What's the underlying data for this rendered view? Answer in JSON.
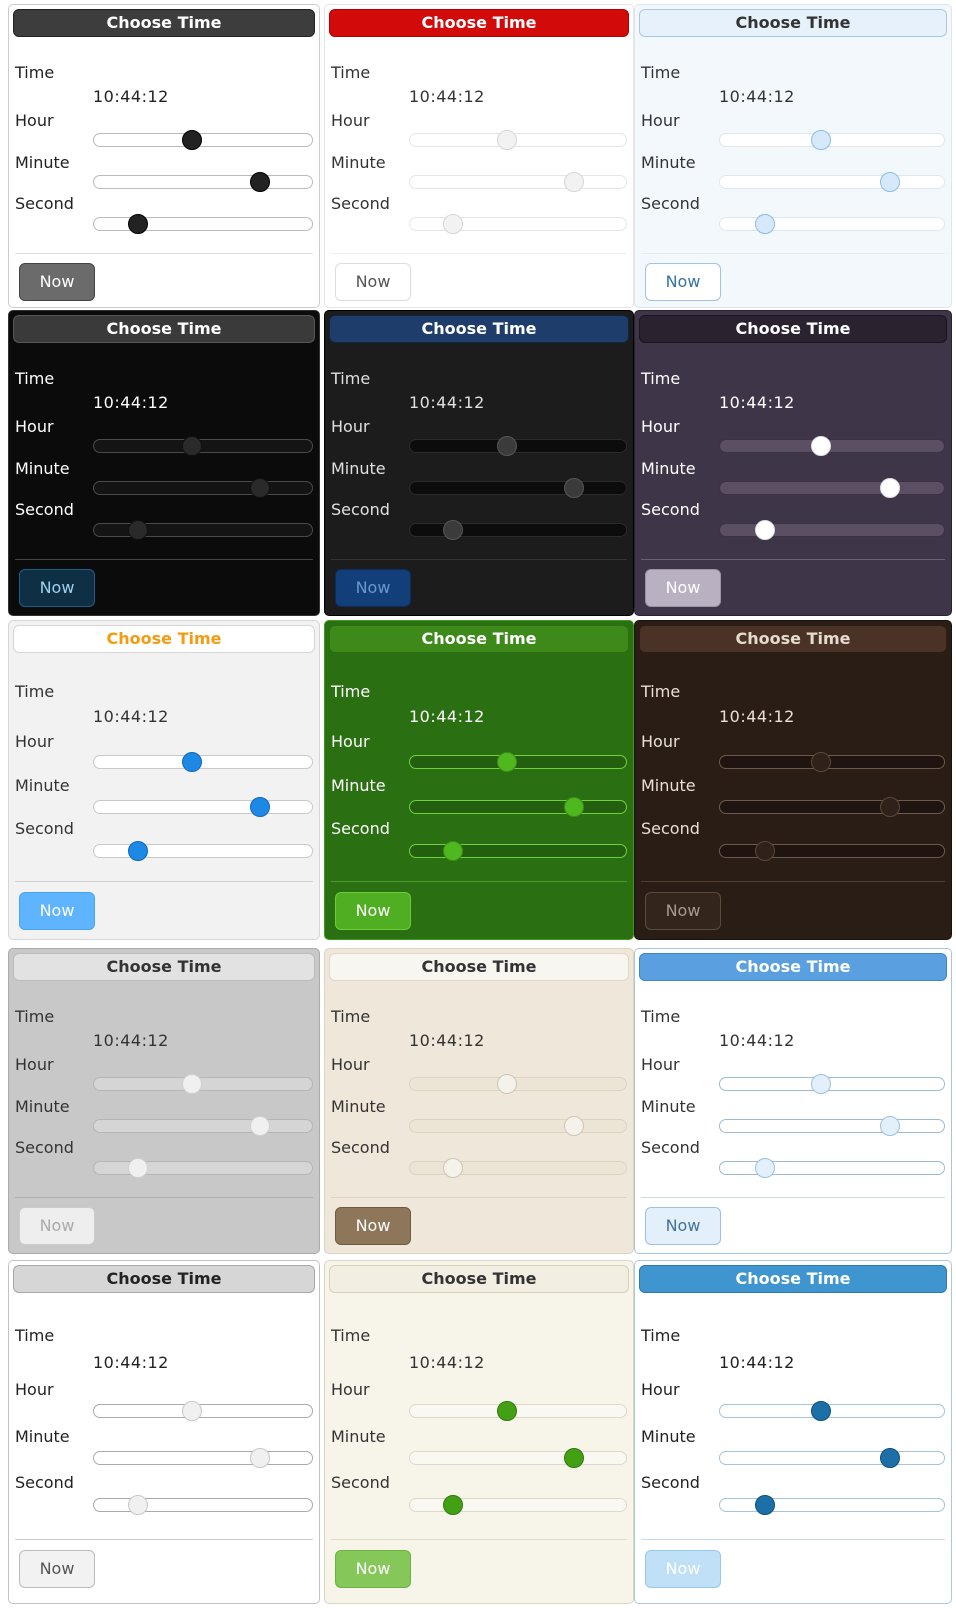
{
  "pickers": [
    {
      "header": "Choose Time",
      "labels": {
        "time": "Time",
        "hour": "Hour",
        "minute": "Minute",
        "second": "Second"
      },
      "time_value": "10:44:12",
      "hour_level": 0.45,
      "minute_level": 0.76,
      "second_level": 0.2,
      "now_label": "Now",
      "colors": {
        "bg": "#ffffff",
        "fg": "#222222",
        "border": "#cccccc",
        "header_bg": "#3d3d3d",
        "header_fg": "#ffffff",
        "header_border": "#222222",
        "track_bg": "#ffffff",
        "track_border": "#bbbbbb",
        "thumb": "#222222",
        "thumb_border": "#000000",
        "sep": "#dddddd",
        "btn_bg": "#6b6b6b",
        "btn_fg": "#ffffff",
        "btn_border": "#444444"
      }
    },
    {
      "header": "Choose Time",
      "labels": {
        "time": "Time",
        "hour": "Hour",
        "minute": "Minute",
        "second": "Second"
      },
      "time_value": "10:44:12",
      "hour_level": 0.45,
      "minute_level": 0.76,
      "second_level": 0.2,
      "now_label": "Now",
      "colors": {
        "bg": "#ffffff",
        "fg": "#333333",
        "border": "#e5e5e5",
        "header_bg": "#d20a0a",
        "header_fg": "#ffffff",
        "header_border": "#b00000",
        "track_bg": "#ffffff",
        "track_border": "#e6e6e6",
        "thumb": "#f2f2f2",
        "thumb_border": "#d6d6d6",
        "sep": "#eeeeee",
        "btn_bg": "#ffffff",
        "btn_fg": "#555555",
        "btn_border": "#dddddd"
      }
    },
    {
      "header": "Choose Time",
      "labels": {
        "time": "Time",
        "hour": "Hour",
        "minute": "Minute",
        "second": "Second"
      },
      "time_value": "10:44:12",
      "hour_level": 0.45,
      "minute_level": 0.76,
      "second_level": 0.2,
      "now_label": "Now",
      "colors": {
        "bg": "#f3f8fc",
        "fg": "#333333",
        "border": "#dde6ee",
        "header_bg": "#e6f1fb",
        "header_fg": "#333333",
        "header_border": "#a9c8e6",
        "track_bg": "#ffffff",
        "track_border": "#dfe6ee",
        "thumb": "#d5e9fb",
        "thumb_border": "#8bbbe8",
        "sep": "#e4ebf1",
        "btn_bg": "#ffffff",
        "btn_fg": "#3572a8",
        "btn_border": "#9ec3e6"
      }
    },
    {
      "header": "Choose Time",
      "labels": {
        "time": "Time",
        "hour": "Hour",
        "minute": "Minute",
        "second": "Second"
      },
      "time_value": "10:44:12",
      "hour_level": 0.45,
      "minute_level": 0.76,
      "second_level": 0.2,
      "now_label": "Now",
      "colors": {
        "bg": "#0b0b0b",
        "fg": "#ffffff",
        "border": "#333333",
        "header_bg": "#3a3a3a",
        "header_fg": "#ffffff",
        "header_border": "#555555",
        "track_bg": "#141414",
        "track_border": "#4a4a4a",
        "thumb": "#2a2a2a",
        "thumb_border": "#111111",
        "sep": "#444444",
        "btn_bg": "#0f2f45",
        "btn_fg": "#9fd0f0",
        "btn_border": "#1c5f8a"
      }
    },
    {
      "header": "Choose Time",
      "labels": {
        "time": "Time",
        "hour": "Hour",
        "minute": "Minute",
        "second": "Second"
      },
      "time_value": "10:44:12",
      "hour_level": 0.45,
      "minute_level": 0.76,
      "second_level": 0.2,
      "now_label": "Now",
      "colors": {
        "bg": "#1c1c1c",
        "fg": "#e0e0e0",
        "border": "#000000",
        "header_bg": "#1f3d6a",
        "header_fg": "#ffffff",
        "header_border": "#112440",
        "track_bg": "#0c0c0c",
        "track_border": "#2a2a2a",
        "thumb": "#3b3b3b",
        "thumb_border": "#555555",
        "sep": "#333333",
        "btn_bg": "#123f7a",
        "btn_fg": "#6c96cc",
        "btn_border": "#0c2c57"
      }
    },
    {
      "header": "Choose Time",
      "labels": {
        "time": "Time",
        "hour": "Hour",
        "minute": "Minute",
        "second": "Second"
      },
      "time_value": "10:44:12",
      "hour_level": 0.45,
      "minute_level": 0.76,
      "second_level": 0.2,
      "now_label": "Now",
      "colors": {
        "bg": "#3f3549",
        "fg": "#ffffff",
        "border": "#2a2230",
        "header_bg": "#2b2230",
        "header_fg": "#ffffff",
        "header_border": "#1b151f",
        "track_bg": "#5a4f63",
        "track_border": "#3b3342",
        "thumb": "#ffffff",
        "thumb_border": "#dddddd",
        "sep": "#6a5f73",
        "btn_bg": "#b9b0c1",
        "btn_fg": "#ffffff",
        "btn_border": "#9d93a6"
      }
    },
    {
      "header": "Choose Time",
      "labels": {
        "time": "Time",
        "hour": "Hour",
        "minute": "Minute",
        "second": "Second"
      },
      "time_value": "10:44:12",
      "hour_level": 0.45,
      "minute_level": 0.76,
      "second_level": 0.2,
      "now_label": "Now",
      "colors": {
        "bg": "#f2f2f2",
        "fg": "#333333",
        "border": "#d6d6d6",
        "header_bg": "#ffffff",
        "header_fg": "#f39c12",
        "header_border": "#d6d6d6",
        "track_bg": "#ffffff",
        "track_border": "#c9c9c9",
        "thumb": "#1e88e5",
        "thumb_border": "#1565c0",
        "sep": "#d0d0d0",
        "btn_bg": "#5eb4ff",
        "btn_fg": "#ffffff",
        "btn_border": "#4aa3f0"
      }
    },
    {
      "header": "Choose Time",
      "labels": {
        "time": "Time",
        "hour": "Hour",
        "minute": "Minute",
        "second": "Second"
      },
      "time_value": "10:44:12",
      "hour_level": 0.45,
      "minute_level": 0.76,
      "second_level": 0.2,
      "now_label": "Now",
      "colors": {
        "bg": "#2a6f12",
        "fg": "#ffffff",
        "border": "#3f9a1a",
        "header_bg": "#3d8a1a",
        "header_fg": "#ffffff",
        "header_border": "#2e6e12",
        "track_bg": "#245f10",
        "track_border": "#6ed23a",
        "thumb": "#4fb81f",
        "thumb_border": "#3a8f15",
        "sep": "#4a9a27",
        "btn_bg": "#4fae22",
        "btn_fg": "#ffffff",
        "btn_border": "#6ccc3a"
      }
    },
    {
      "header": "Choose Time",
      "labels": {
        "time": "Time",
        "hour": "Hour",
        "minute": "Minute",
        "second": "Second"
      },
      "time_value": "10:44:12",
      "hour_level": 0.45,
      "minute_level": 0.76,
      "second_level": 0.2,
      "now_label": "Now",
      "colors": {
        "bg": "#2a1d16",
        "fg": "#e8e0d8",
        "border": "#1c120d",
        "header_bg": "#4a3326",
        "header_fg": "#e5dccf",
        "header_border": "#2c1e16",
        "track_bg": "#1f140f",
        "track_border": "#6d5a4c",
        "thumb": "#2f221a",
        "thumb_border": "#5b4739",
        "sep": "#4e3d31",
        "btn_bg": "#33251c",
        "btn_fg": "#a59b8c",
        "btn_border": "#5b4b3e"
      }
    },
    {
      "header": "Choose Time",
      "labels": {
        "time": "Time",
        "hour": "Hour",
        "minute": "Minute",
        "second": "Second"
      },
      "time_value": "10:44:12",
      "hour_level": 0.45,
      "minute_level": 0.76,
      "second_level": 0.2,
      "now_label": "Now",
      "colors": {
        "bg": "#c8c8c8",
        "fg": "#333333",
        "border": "#aaaaaa",
        "header_bg": "#e2e2e2",
        "header_fg": "#333333",
        "header_border": "#bbbbbb",
        "track_bg": "#d5d5d5",
        "track_border": "#b5b5b5",
        "thumb": "#f0f0f0",
        "thumb_border": "#d0d0d0",
        "sep": "#b0b0b0",
        "btn_bg": "#eeeeee",
        "btn_fg": "#aaaaaa",
        "btn_border": "#cccccc"
      }
    },
    {
      "header": "Choose Time",
      "labels": {
        "time": "Time",
        "hour": "Hour",
        "minute": "Minute",
        "second": "Second"
      },
      "time_value": "10:44:12",
      "hour_level": 0.45,
      "minute_level": 0.76,
      "second_level": 0.2,
      "now_label": "Now",
      "colors": {
        "bg": "#efe8da",
        "fg": "#333333",
        "border": "#ddd3c2",
        "header_bg": "#f8f6f1",
        "header_fg": "#333333",
        "header_border": "#e2d8c8",
        "track_bg": "#ece5d6",
        "track_border": "#ddd3c2",
        "thumb": "#f5f2ec",
        "thumb_border": "#cfc4b3",
        "sep": "#ded4c4",
        "btn_bg": "#8d7659",
        "btn_fg": "#ffffff",
        "btn_border": "#6f5b43"
      }
    },
    {
      "header": "Choose Time",
      "labels": {
        "time": "Time",
        "hour": "Hour",
        "minute": "Minute",
        "second": "Second"
      },
      "time_value": "10:44:12",
      "hour_level": 0.45,
      "minute_level": 0.76,
      "second_level": 0.2,
      "now_label": "Now",
      "colors": {
        "bg": "#ffffff",
        "fg": "#333333",
        "border": "#a7c4e0",
        "header_bg": "#5aa0e0",
        "header_fg": "#ffffff",
        "header_border": "#3f86c8",
        "track_bg": "#ffffff",
        "track_border": "#9dbad6",
        "thumb": "#e3effa",
        "thumb_border": "#9dc0e3",
        "sep": "#c9dcee",
        "btn_bg": "#e3effa",
        "btn_fg": "#447299",
        "btn_border": "#9dc0e3"
      }
    },
    {
      "header": "Choose Time",
      "labels": {
        "time": "Time",
        "hour": "Hour",
        "minute": "Minute",
        "second": "Second"
      },
      "time_value": "10:44:12",
      "hour_level": 0.45,
      "minute_level": 0.76,
      "second_level": 0.2,
      "now_label": "Now",
      "colors": {
        "bg": "#ffffff",
        "fg": "#222222",
        "border": "#c2c2c2",
        "header_bg": "#d6d6d6",
        "header_fg": "#222222",
        "header_border": "#a8a8a8",
        "track_bg": "#ffffff",
        "track_border": "#aaaaaa",
        "thumb": "#f0f0f0",
        "thumb_border": "#c8c8c8",
        "sep": "#cccccc",
        "btn_bg": "#f2f2f2",
        "btn_fg": "#555555",
        "btn_border": "#bbbbbb"
      }
    },
    {
      "header": "Choose Time",
      "labels": {
        "time": "Time",
        "hour": "Hour",
        "minute": "Minute",
        "second": "Second"
      },
      "time_value": "10:44:12",
      "hour_level": 0.45,
      "minute_level": 0.76,
      "second_level": 0.2,
      "now_label": "Now",
      "colors": {
        "bg": "#f7f4ea",
        "fg": "#333333",
        "border": "#ddd6c3",
        "header_bg": "#f2eee2",
        "header_fg": "#333333",
        "header_border": "#d8cfb8",
        "track_bg": "#faf8f2",
        "track_border": "#e0d9c7",
        "thumb": "#43a014",
        "thumb_border": "#2f7a0c",
        "sep": "#e2dccc",
        "btn_bg": "#86c75a",
        "btn_fg": "#ffffff",
        "btn_border": "#6fb043"
      }
    },
    {
      "header": "Choose Time",
      "labels": {
        "time": "Time",
        "hour": "Hour",
        "minute": "Minute",
        "second": "Second"
      },
      "time_value": "10:44:12",
      "hour_level": 0.45,
      "minute_level": 0.76,
      "second_level": 0.2,
      "now_label": "Now",
      "colors": {
        "bg": "#ffffff",
        "fg": "#222222",
        "border": "#a9c8e3",
        "header_bg": "#3f95cf",
        "header_fg": "#ffffff",
        "header_border": "#2f79ad",
        "track_bg": "#ffffff",
        "track_border": "#a6c3dc",
        "thumb": "#1d6fa8",
        "thumb_border": "#0f4f80",
        "sep": "#c6dbeb",
        "btn_bg": "#bfe0f7",
        "btn_fg": "#ffffff",
        "btn_border": "#98c7e8"
      }
    }
  ]
}
